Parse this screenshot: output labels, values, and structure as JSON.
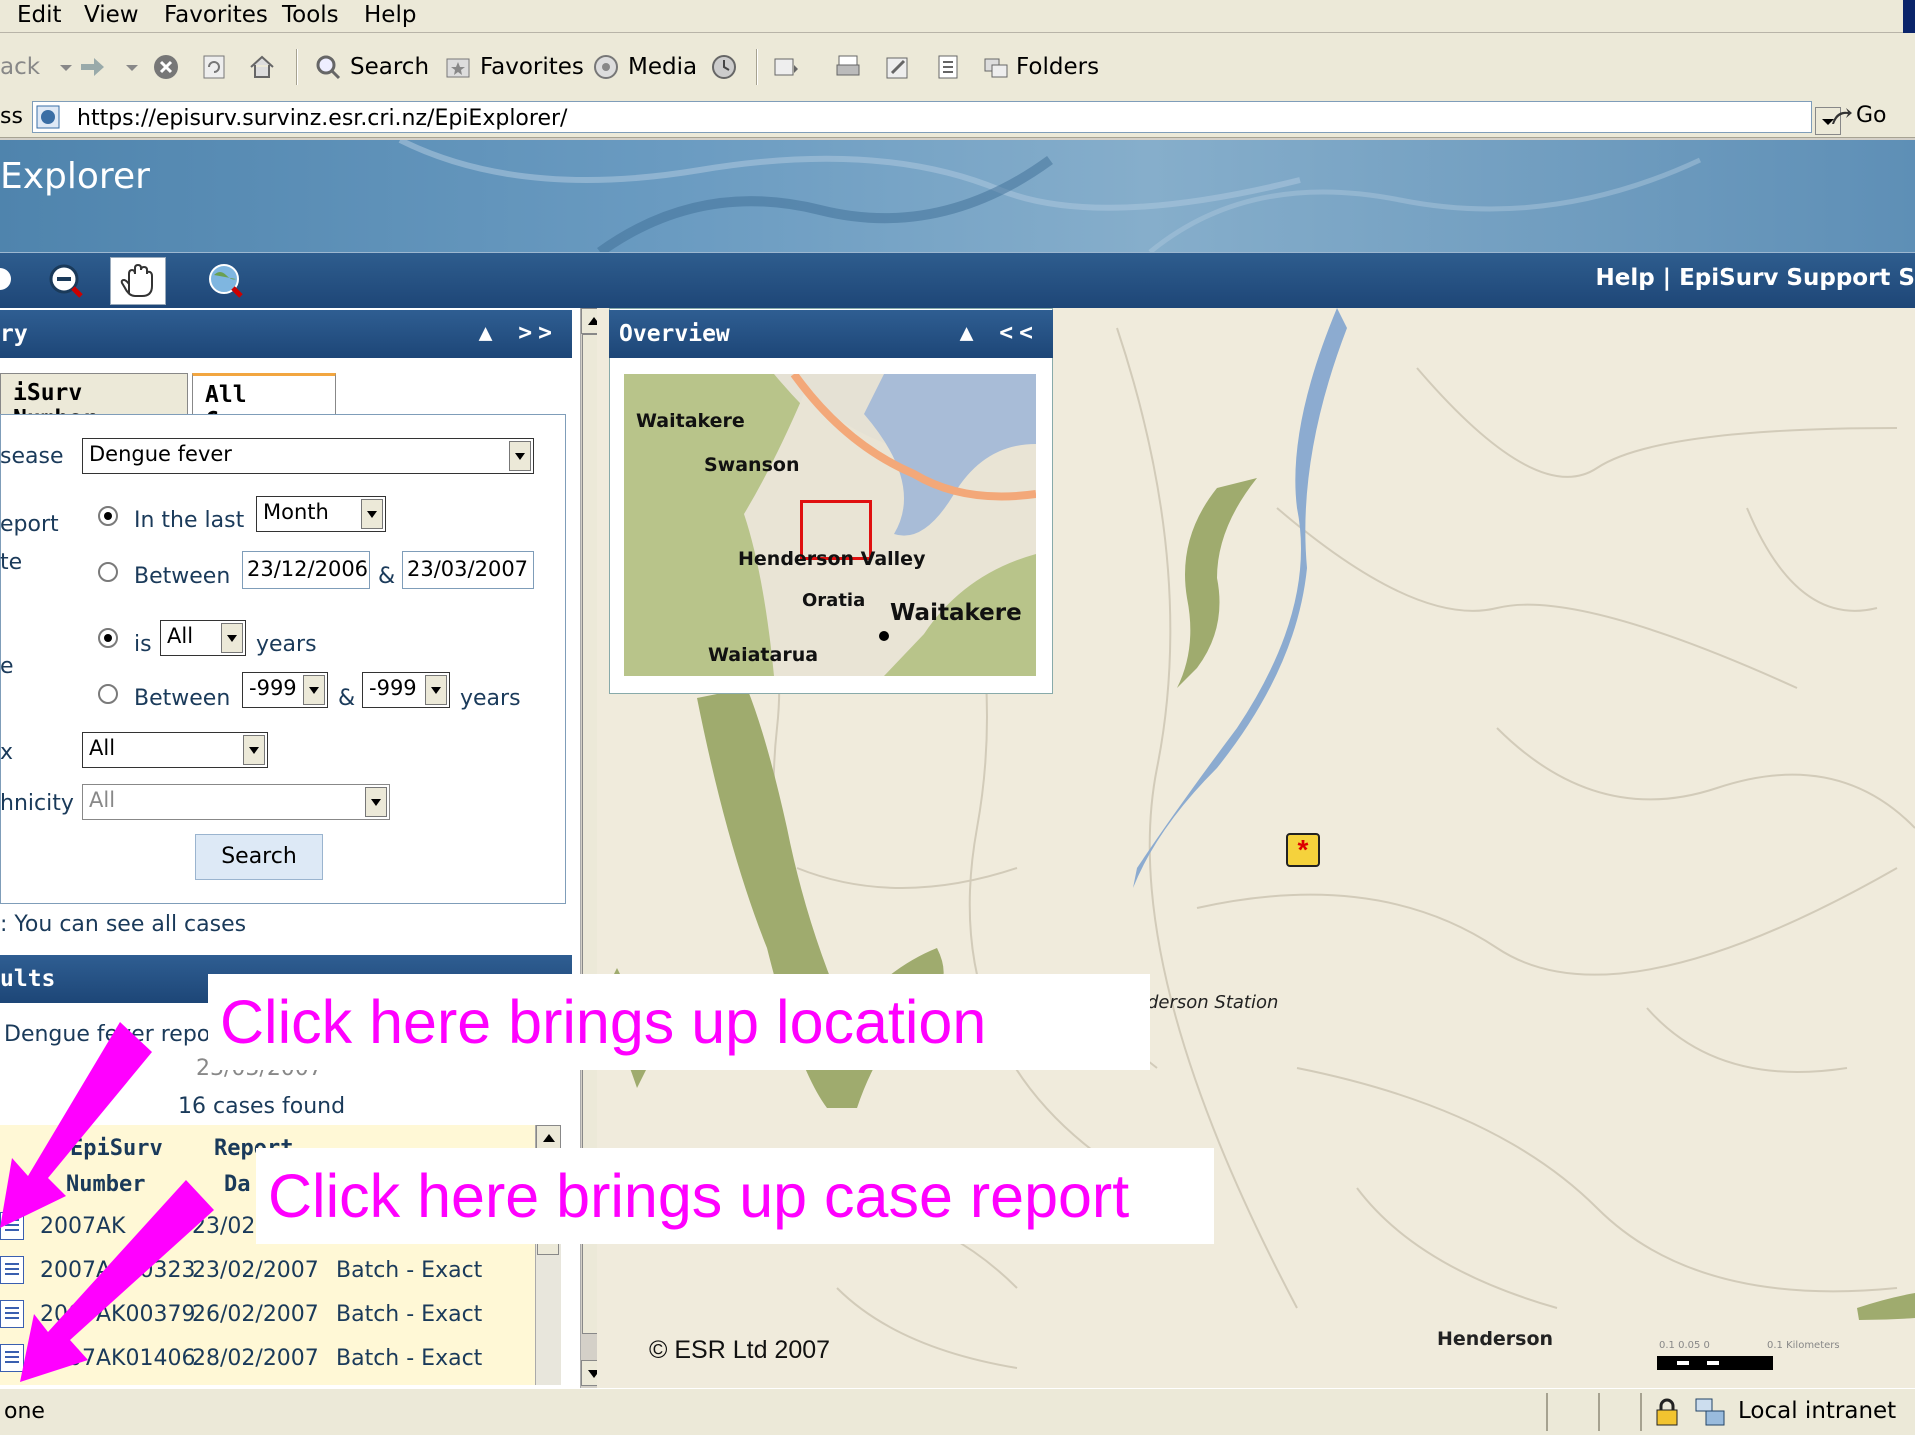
{
  "menu": {
    "items": [
      "Edit",
      "View",
      "Favorites",
      "Tools",
      "Help"
    ]
  },
  "toolbar": {
    "back_label": "ack",
    "search_label": "Search",
    "favorites_label": "Favorites",
    "media_label": "Media",
    "folders_label": "Folders"
  },
  "address": {
    "label": "ss",
    "url": "https://episurv.survinz.esr.cri.nz/EpiExplorer/",
    "go_label": "Go"
  },
  "banner": {
    "title": "Explorer"
  },
  "header_links": {
    "text": "Help | EpiSurv Support S"
  },
  "query_panel": {
    "title": "ry",
    "controls": "▲ >>",
    "tabs": [
      "iSurv Number",
      "All Cases"
    ],
    "disease_label": "sease",
    "disease_value": "Dengue fever",
    "report_label_1": "eport",
    "report_label_2": "te",
    "in_the_last_label": "In the last",
    "in_the_last_value": "Month",
    "between_label": "Between",
    "date_from": "23/12/2006",
    "date_amp": "&",
    "date_to": "23/03/2007",
    "age_label": "e",
    "is_label": "is",
    "age_value": "All",
    "years_label": "years",
    "age_between_label": "Between",
    "age_from": "-999",
    "age_amp": "&",
    "age_to": "-999",
    "age_years_label": "years",
    "sex_label": "x",
    "sex_value": "All",
    "ethnicity_label": "hnicity",
    "ethnicity_value": "All",
    "search_button": "Search",
    "note": ": You can see all cases"
  },
  "results_panel": {
    "title": "ults",
    "summary_line1": "Dengue fever repo",
    "summary_line2": "23/03/2007",
    "cases_found": "16 cases found",
    "col_episurv_1": "EpiSurv",
    "col_episurv_2": "Number",
    "col_report_1": "Report",
    "col_report_2": "Da",
    "rows": [
      {
        "number": "2007AK",
        "date": "23/02",
        "method": ""
      },
      {
        "number": "2007AK00323",
        "date": "23/02/2007",
        "method": "Batch - Exact"
      },
      {
        "number": "2007AK00379",
        "date": "26/02/2007",
        "method": "Batch - Exact"
      },
      {
        "number": "2007AK01406",
        "date": "28/02/2007",
        "method": "Batch - Exact"
      }
    ]
  },
  "overview": {
    "title": "Overview",
    "controls": "▲ <<",
    "places": [
      "Waitakere",
      "Swanson",
      "Henderson Valley",
      "Oratia",
      "Waitakere",
      "Waiatarua"
    ]
  },
  "map": {
    "place_station": "derson Station",
    "place_henderson": "Henderson",
    "copyright": "© ESR Ltd 2007",
    "scale_labels": [
      "0.1 0.05   0",
      "0.1 Kilometers"
    ],
    "marker_symbol": "*"
  },
  "status": {
    "text": "one",
    "zone": "Local intranet"
  },
  "annotations": {
    "location": "Click here brings up location",
    "case_report": "Click here brings up case report"
  },
  "colors": {
    "annotation": "#ff00ff",
    "header_blue": "#1d4677",
    "map_bg": "#f0ebdc",
    "park_green": "#9fab6e",
    "river_blue": "#8cabd0"
  }
}
